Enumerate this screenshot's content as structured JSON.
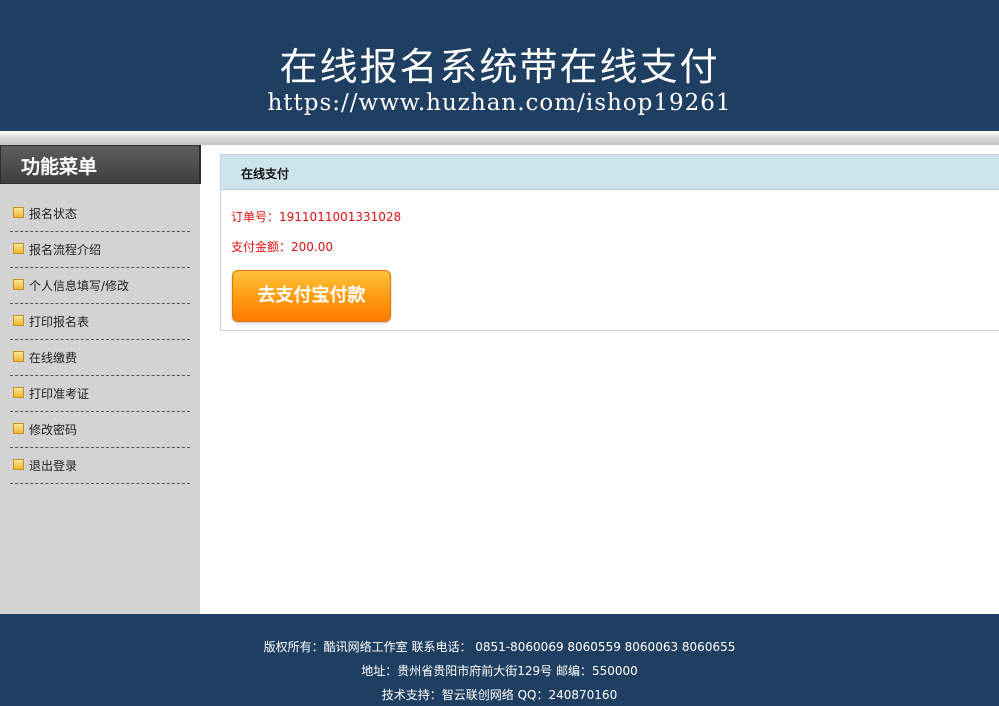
{
  "header": {
    "title": "在线报名系统带在线支付",
    "url": "https://www.huzhan.com/ishop19261"
  },
  "sidebar": {
    "title": "功能菜单",
    "items": [
      {
        "label": "报名状态"
      },
      {
        "label": "报名流程介绍"
      },
      {
        "label": "个人信息填写/修改"
      },
      {
        "label": "打印报名表"
      },
      {
        "label": "在线缴费"
      },
      {
        "label": "打印准考证"
      },
      {
        "label": "修改密码"
      },
      {
        "label": "退出登录"
      }
    ]
  },
  "payment": {
    "panel_title": "在线支付",
    "order_label": "订单号：",
    "order_number": "1911011001331028",
    "amount_label": "支付金额：",
    "amount": "200.00",
    "button_label": "去支付宝付款"
  },
  "footer": {
    "line1": "版权所有：酷讯网络工作室 联系电话： 0851-8060069 8060559 8060063 8060655",
    "line2": "地址：贵州省贵阳市府前大街129号 邮编：550000",
    "line3": "技术支持：智云联创网络 QQ：240870160"
  },
  "colors": {
    "header_bg": "#1f3f62",
    "sidebar_bg": "#d3d3d3",
    "panel_head_bg": "#cde4ec",
    "alert_text": "#e01010",
    "button_orange": "#ff8c00"
  }
}
